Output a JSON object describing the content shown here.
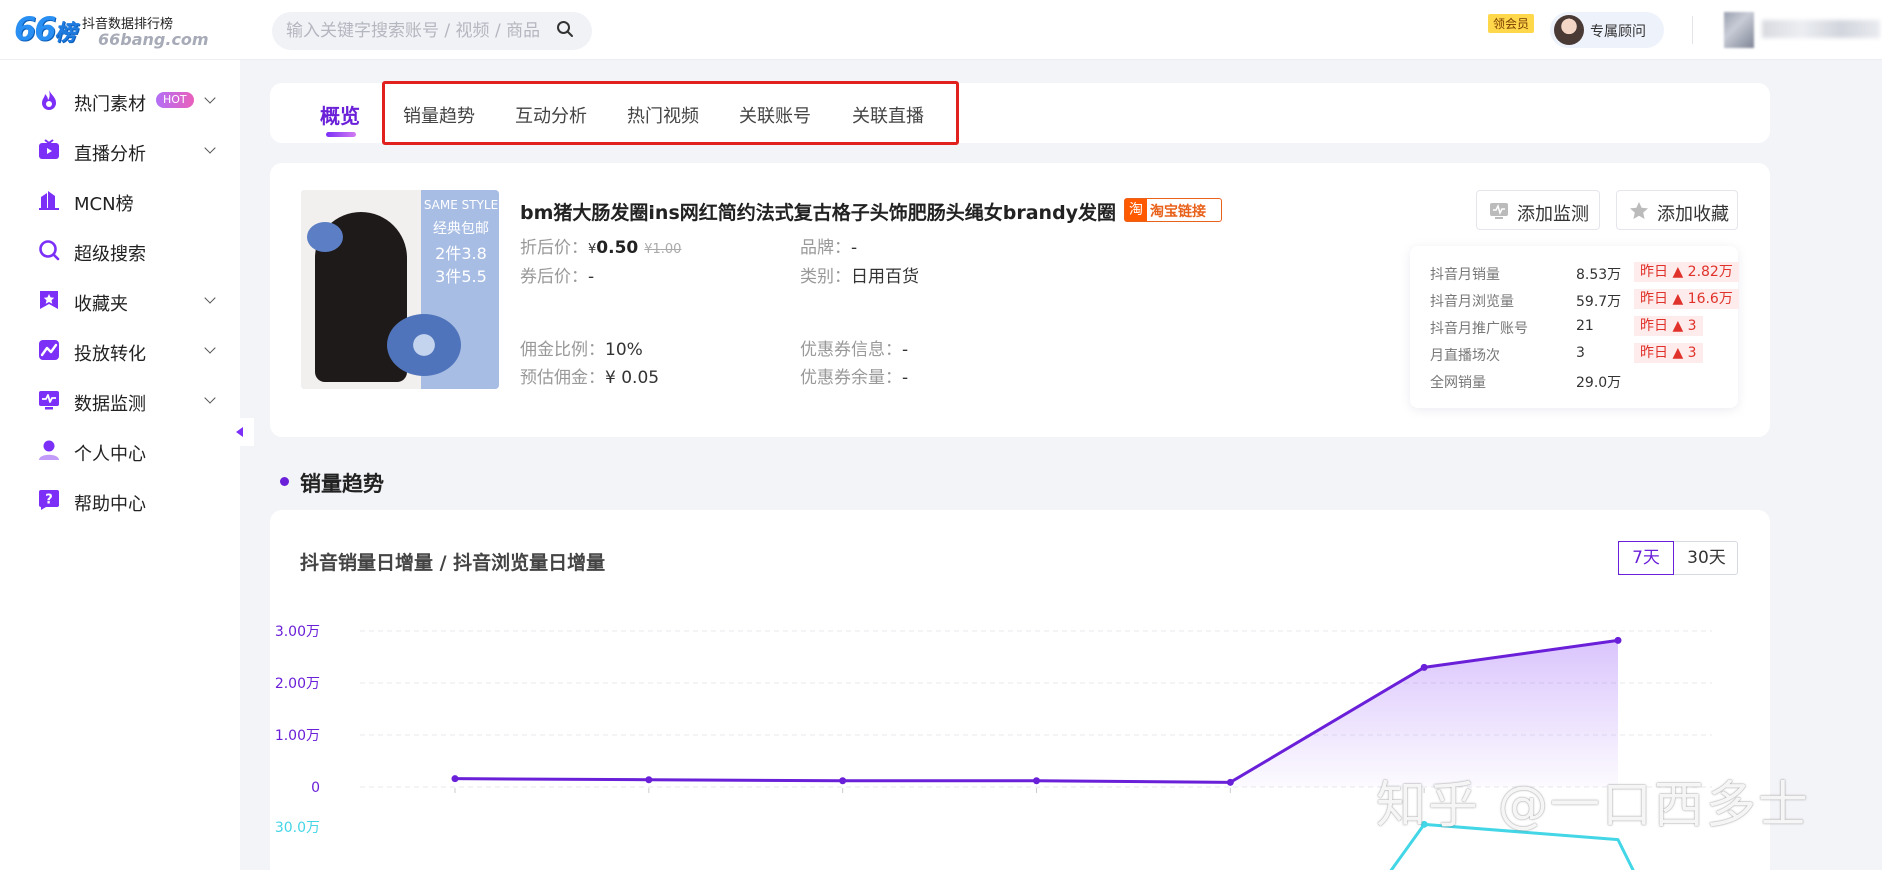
{
  "header": {
    "logo_mark": "66",
    "logo_mark_suffix": "榜",
    "logo_name": "抖音数据排行榜",
    "logo_domain": "66bang.com",
    "search_placeholder": "输入关键字搜索账号 / 视频 / 商品",
    "vip_badge": "领会员",
    "advisor_label": "专属顾问"
  },
  "sidebar": {
    "items": [
      {
        "label": "热门素材",
        "icon": "fire-icon",
        "badge": "HOT",
        "has_chevron": true
      },
      {
        "label": "直播分析",
        "icon": "tv-icon",
        "has_chevron": true
      },
      {
        "label": "MCN榜",
        "icon": "building-icon",
        "has_chevron": false
      },
      {
        "label": "超级搜索",
        "icon": "search-icon",
        "has_chevron": false
      },
      {
        "label": "收藏夹",
        "icon": "star-icon",
        "has_chevron": true
      },
      {
        "label": "投放转化",
        "icon": "chart-icon",
        "has_chevron": true
      },
      {
        "label": "数据监测",
        "icon": "monitor-icon",
        "has_chevron": true
      },
      {
        "label": "个人中心",
        "icon": "user-icon",
        "has_chevron": false
      },
      {
        "label": "帮助中心",
        "icon": "help-icon",
        "has_chevron": false
      }
    ]
  },
  "tabs": [
    {
      "label": "概览",
      "active": true
    },
    {
      "label": "销量趋势"
    },
    {
      "label": "互动分析"
    },
    {
      "label": "热门视频"
    },
    {
      "label": "关联账号"
    },
    {
      "label": "关联直播"
    }
  ],
  "product": {
    "title": "bm猪大肠发圈ins网红简约法式复古格子头饰肥肠头绳女brandy发圈",
    "taobao_icon": "淘",
    "taobao_link": "淘宝链接",
    "image_text": [
      "SAME STYLE",
      "经典包邮",
      "2件3.8",
      "3件5.5"
    ],
    "discount_price_label": "折后价：",
    "currency": "¥",
    "discount_price": "0.50",
    "original_price": "¥1.00",
    "coupon_price_label": "券后价：",
    "coupon_price": "-",
    "brand_label": "品牌：",
    "brand": "-",
    "category_label": "类别：",
    "category": "日用百货",
    "commission_rate_label": "佣金比例：",
    "commission_rate": "10%",
    "est_commission_label": "预估佣金：",
    "est_commission": "¥ 0.05",
    "coupon_info_label": "优惠券信息：",
    "coupon_info": "-",
    "coupon_left_label": "优惠券余量：",
    "coupon_left": "-",
    "add_monitor": "添加监测",
    "add_favorite": "添加收藏"
  },
  "stats": [
    {
      "label": "抖音月销量",
      "value": "8.53万",
      "change": "昨日 ▲ 2.82万"
    },
    {
      "label": "抖音月浏览量",
      "value": "59.7万",
      "change": "昨日 ▲ 16.6万"
    },
    {
      "label": "抖音月推广账号",
      "value": "21",
      "change": "昨日 ▲ 3"
    },
    {
      "label": "月直播场次",
      "value": "3",
      "change": "昨日 ▲ 3"
    },
    {
      "label": "全网销量",
      "value": "29.0万",
      "change": ""
    }
  ],
  "section": {
    "title": "销量趋势"
  },
  "chart": {
    "title": "抖音销量日增量 / 抖音浏览量日增量",
    "range_options": [
      "7天",
      "30天"
    ],
    "range_selected": "7天"
  },
  "chart_data": {
    "type": "line",
    "title": "抖音销量日增量 / 抖音浏览量日增量",
    "xlabel": "",
    "ylabel": "",
    "y_ticks": [
      "3.00万",
      "2.00万",
      "1.00万",
      "0"
    ],
    "y2_ticks": [
      "30.0万"
    ],
    "ylim": [
      0,
      30000
    ],
    "series": [
      {
        "values": [
          1600,
          1400,
          1200,
          1200,
          900,
          23000,
          28200
        ],
        "color": "#6a1fd8",
        "fill": true
      },
      {
        "values": [
          null,
          null,
          null,
          null,
          null,
          66000,
          48000
        ],
        "color": "#43d6e6",
        "fill": false
      }
    ],
    "grid": true
  },
  "watermark": "知乎 @一口西多士",
  "colors": {
    "accent": "#6a1fd8",
    "highlight": "#e0211d",
    "up": "#e0322b",
    "secondary_series": "#43d6e6"
  }
}
